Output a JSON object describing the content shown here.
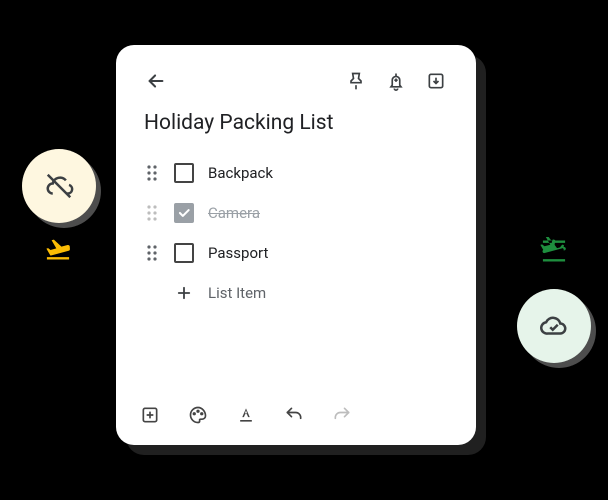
{
  "note": {
    "title": "Holiday Packing List",
    "items": [
      {
        "text": "Backpack",
        "checked": false
      },
      {
        "text": "Camera",
        "checked": true
      },
      {
        "text": "Passport",
        "checked": false
      }
    ],
    "newItemPlaceholder": "List Item"
  },
  "icons": {
    "leftBlob": "cloud-off-icon",
    "rightBlob": "cloud-done-icon",
    "leftPlane": "flight-takeoff-icon",
    "rightPlane": "flight-land-icon"
  }
}
